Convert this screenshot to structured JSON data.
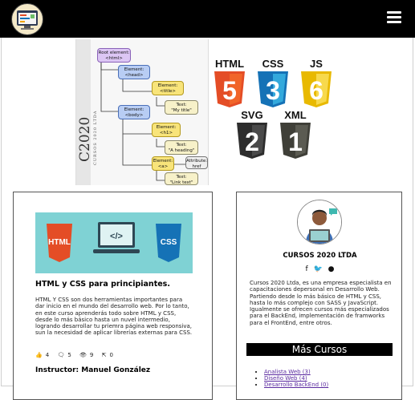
{
  "header": {
    "logo_icon": "code-editor-icon",
    "menu_icon": "hamburger-icon"
  },
  "hero": {
    "side_title": "C2020",
    "side_subtitle": "CURSOS 2020 LTDA",
    "tree": {
      "root": {
        "kind": "Root element:",
        "tag": "<html>"
      },
      "head": {
        "kind": "Element:",
        "tag": "<head>"
      },
      "title": {
        "kind": "Element:",
        "tag": "<title>"
      },
      "title_text": {
        "kind": "Text:",
        "value": "\"My title\""
      },
      "body": {
        "kind": "Element:",
        "tag": "<body>"
      },
      "h1": {
        "kind": "Element:",
        "tag": "<h1>"
      },
      "h1_text": {
        "kind": "Text:",
        "value": "\"A heading\""
      },
      "a": {
        "kind": "Element:",
        "tag": "<a>"
      },
      "a_attr": {
        "kind": "Attribute:",
        "value": "href"
      },
      "a_text": {
        "kind": "Text:",
        "value": "\"Link text\""
      }
    },
    "badges": [
      {
        "label": "HTML",
        "digit": "5",
        "color": "#e44d26",
        "icon": "html5-shield-icon"
      },
      {
        "label": "CSS",
        "digit": "3",
        "color": "#1572b6",
        "icon": "css3-shield-icon"
      },
      {
        "label": "JS",
        "digit": "6",
        "color": "#f0c800",
        "icon": "js6-shield-icon"
      },
      {
        "label": "SVG",
        "digit": "2",
        "color": "#3b3b3b",
        "icon": "svg2-shield-icon"
      },
      {
        "label": "XML",
        "digit": "1",
        "color": "#4a4a42",
        "icon": "xml1-shield-icon"
      }
    ]
  },
  "course": {
    "banner": {
      "left": "HTML",
      "center": "</>",
      "right": "CSS"
    },
    "title": "HTML y CSS para principiantes.",
    "description": "HTML Y CSS son dos herramientas importantes para dar inicio en el mundo del desarrollo web. Por lo tanto, en este curso aprenderás todo sobre HTML y CSS, desde lo más básico hasta un nuvel intermedio, logrando desarrollar tu priemra página web responsiva, sun la necesidad de aplicar librerías externas para CSS.",
    "stats": {
      "likes": "4",
      "comments": "5",
      "views": "9",
      "shares": "0"
    },
    "instructor": "Instructor: Manuel González"
  },
  "profile": {
    "brand": "CURSOS 2020 LTDA",
    "socials": [
      "facebook-icon",
      "twitter-icon",
      "github-icon"
    ],
    "about": "Cursos 2020 Ltda, es una empresa especialista en capacitaciones depersonal en Desarrollo Web. Partiendo desde lo más básico de HTML y CSS, hasta lo más complejo con SASS y JavaScript. Igualmente se ofrecen cursos más especializados para el BackEnd, implementación de framworks para el FrontEnd, entre otros.",
    "more_title": "Más Cursos",
    "more_courses": [
      "Analista Web (3)",
      "Diseño Web (4)",
      "Desarrollo BackEnd (0)"
    ]
  },
  "colors": {
    "topbar": "#000000",
    "banner": "#7fd2d4",
    "link": "#5b2aa0"
  }
}
